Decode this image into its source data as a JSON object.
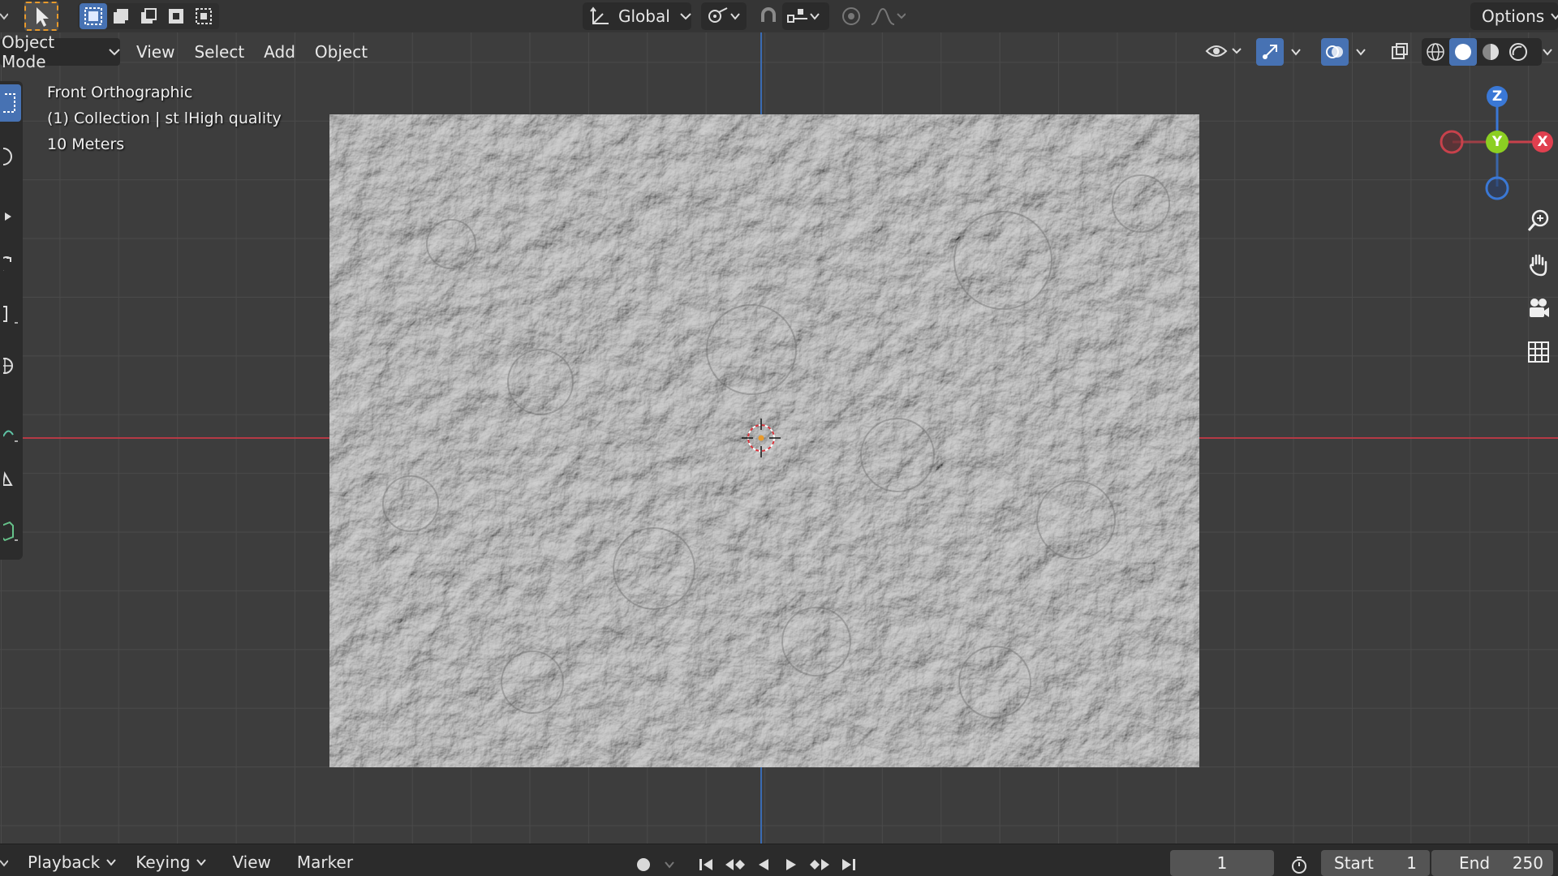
{
  "header": {
    "transform_orientation": "Global",
    "options_label": "Options"
  },
  "viewport_header": {
    "mode": "Object Mode",
    "menus": [
      "View",
      "Select",
      "Add",
      "Object"
    ]
  },
  "overlay": {
    "view_name": "Front Orthographic",
    "collection": "(1) Collection | st lHigh quality",
    "scale": "10 Meters"
  },
  "gizmo": {
    "z_label": "Z",
    "y_label": "Y",
    "x_label": "X",
    "colors": {
      "x": "#e0404f",
      "y": "#8ccf22",
      "z": "#3a78d6"
    }
  },
  "timeline": {
    "menus": [
      "Playback",
      "Keying",
      "View",
      "Marker"
    ],
    "current_frame": "1",
    "start_label": "Start",
    "start_value": "1",
    "end_label": "End",
    "end_value": "250"
  },
  "colors": {
    "accent": "#e89a2c",
    "active_blue": "#4772b3",
    "axis_red": "#c8414b",
    "axis_blue": "#3a78d6"
  }
}
